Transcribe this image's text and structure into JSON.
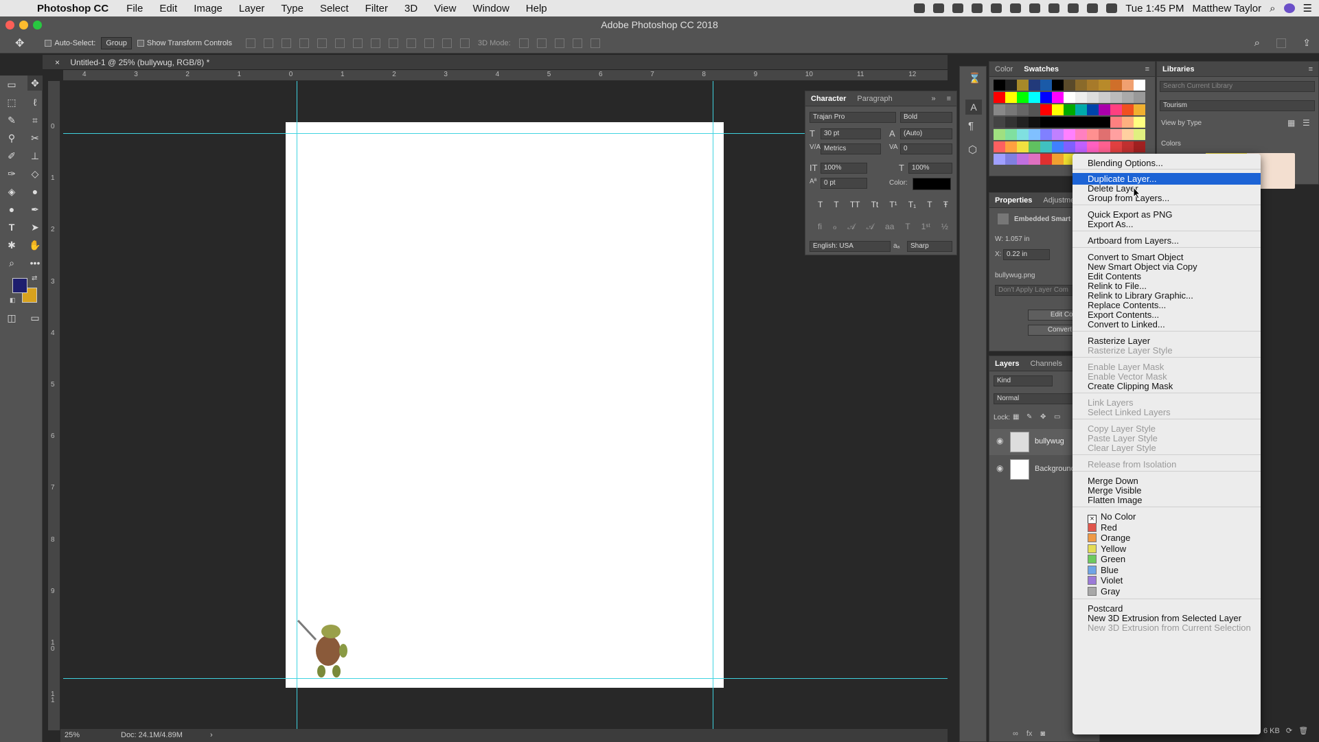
{
  "menubar": {
    "app": "Photoshop CC",
    "items": [
      "File",
      "Edit",
      "Image",
      "Layer",
      "Type",
      "Select",
      "Filter",
      "3D",
      "View",
      "Window",
      "Help"
    ],
    "clock": "Tue 1:45 PM",
    "user": "Matthew Taylor"
  },
  "window_title": "Adobe Photoshop CC 2018",
  "options": {
    "auto_select": "Auto-Select:",
    "group": "Group",
    "show_transform": "Show Transform Controls",
    "mode3d": "3D Mode:"
  },
  "doc_tab": "Untitled-1 @ 25% (bullywug, RGB/8) *",
  "ruler_h": [
    "4",
    "3",
    "2",
    "1",
    "0",
    "1",
    "2",
    "3",
    "4",
    "5",
    "6",
    "7",
    "8",
    "9",
    "10",
    "11",
    "12"
  ],
  "ruler_v": [
    "0",
    "1",
    "2",
    "3",
    "4",
    "5",
    "6",
    "7",
    "8",
    "9",
    "1 0",
    "1 1"
  ],
  "status": {
    "zoom": "25%",
    "doc": "Doc: 24.1M/4.89M"
  },
  "character": {
    "tab1": "Character",
    "tab2": "Paragraph",
    "font": "Trajan Pro",
    "style": "Bold",
    "size": "30 pt",
    "leading": "(Auto)",
    "kerning": "Metrics",
    "tracking": "0",
    "vscale": "100%",
    "hscale": "100%",
    "baseline": "0 pt",
    "color_label": "Color:",
    "language": "English: USA",
    "antialias": "Sharp"
  },
  "color_panel": {
    "tab1": "Color",
    "tab2": "Swatches"
  },
  "libraries": {
    "title": "Libraries",
    "search": "Search Current Library",
    "library": "Tourism",
    "view_by": "View by Type",
    "colors": "Colors"
  },
  "properties": {
    "tab1": "Properties",
    "tab2": "Adjustme",
    "type": "Embedded Smart",
    "w": "W: 1.057 in",
    "x": "0.22 in",
    "file": "bullywug.png",
    "dont_apply": "Don't Apply Layer Com",
    "edit_btn": "Edit Con",
    "convert_btn": "Convert to"
  },
  "layers": {
    "tab1": "Layers",
    "tab2": "Channels",
    "kind": "Kind",
    "blend": "Normal",
    "lock": "Lock:",
    "items": [
      {
        "name": "bullywug"
      },
      {
        "name": "Background"
      }
    ],
    "size": "6 KB"
  },
  "context_menu": {
    "items": [
      {
        "label": "Blending Options...",
        "state": "normal"
      },
      {
        "label": "Duplicate Layer...",
        "state": "highlight"
      },
      {
        "label": "Delete Layer",
        "state": "normal"
      },
      {
        "label": "Group from Layers...",
        "state": "normal"
      },
      {
        "label": "Quick Export as PNG",
        "state": "normal"
      },
      {
        "label": "Export As...",
        "state": "normal"
      },
      {
        "label": "Artboard from Layers...",
        "state": "normal"
      },
      {
        "label": "Convert to Smart Object",
        "state": "normal"
      },
      {
        "label": "New Smart Object via Copy",
        "state": "normal"
      },
      {
        "label": "Edit Contents",
        "state": "normal"
      },
      {
        "label": "Relink to File...",
        "state": "normal"
      },
      {
        "label": "Relink to Library Graphic...",
        "state": "normal"
      },
      {
        "label": "Replace Contents...",
        "state": "normal"
      },
      {
        "label": "Export Contents...",
        "state": "normal"
      },
      {
        "label": "Convert to Linked...",
        "state": "normal"
      },
      {
        "label": "Rasterize Layer",
        "state": "normal"
      },
      {
        "label": "Rasterize Layer Style",
        "state": "disabled"
      },
      {
        "label": "Enable Layer Mask",
        "state": "disabled"
      },
      {
        "label": "Enable Vector Mask",
        "state": "disabled"
      },
      {
        "label": "Create Clipping Mask",
        "state": "normal"
      },
      {
        "label": "Link Layers",
        "state": "disabled"
      },
      {
        "label": "Select Linked Layers",
        "state": "disabled"
      },
      {
        "label": "Copy Layer Style",
        "state": "disabled"
      },
      {
        "label": "Paste Layer Style",
        "state": "disabled"
      },
      {
        "label": "Clear Layer Style",
        "state": "disabled"
      },
      {
        "label": "Release from Isolation",
        "state": "disabled"
      },
      {
        "label": "Merge Down",
        "state": "normal"
      },
      {
        "label": "Merge Visible",
        "state": "normal"
      },
      {
        "label": "Flatten Image",
        "state": "normal"
      },
      {
        "label": "No Color",
        "state": "normal",
        "swatch": "none"
      },
      {
        "label": "Red",
        "state": "normal",
        "swatch": "#e0564c"
      },
      {
        "label": "Orange",
        "state": "normal",
        "swatch": "#ef9a46"
      },
      {
        "label": "Yellow",
        "state": "normal",
        "swatch": "#e4dc55"
      },
      {
        "label": "Green",
        "state": "normal",
        "swatch": "#6dca5e"
      },
      {
        "label": "Blue",
        "state": "normal",
        "swatch": "#6ea4e6"
      },
      {
        "label": "Violet",
        "state": "normal",
        "swatch": "#9b7ad8"
      },
      {
        "label": "Gray",
        "state": "normal",
        "swatch": "#a8a8a8"
      },
      {
        "label": "Postcard",
        "state": "normal"
      },
      {
        "label": "New 3D Extrusion from Selected Layer",
        "state": "normal"
      },
      {
        "label": "New 3D Extrusion from Current Selection",
        "state": "disabled"
      }
    ]
  },
  "colors": {
    "foreground": "#1e1e6e",
    "background": "#d8a21e",
    "guide": "#3fd3e0",
    "highlight": "#1c63d5"
  }
}
